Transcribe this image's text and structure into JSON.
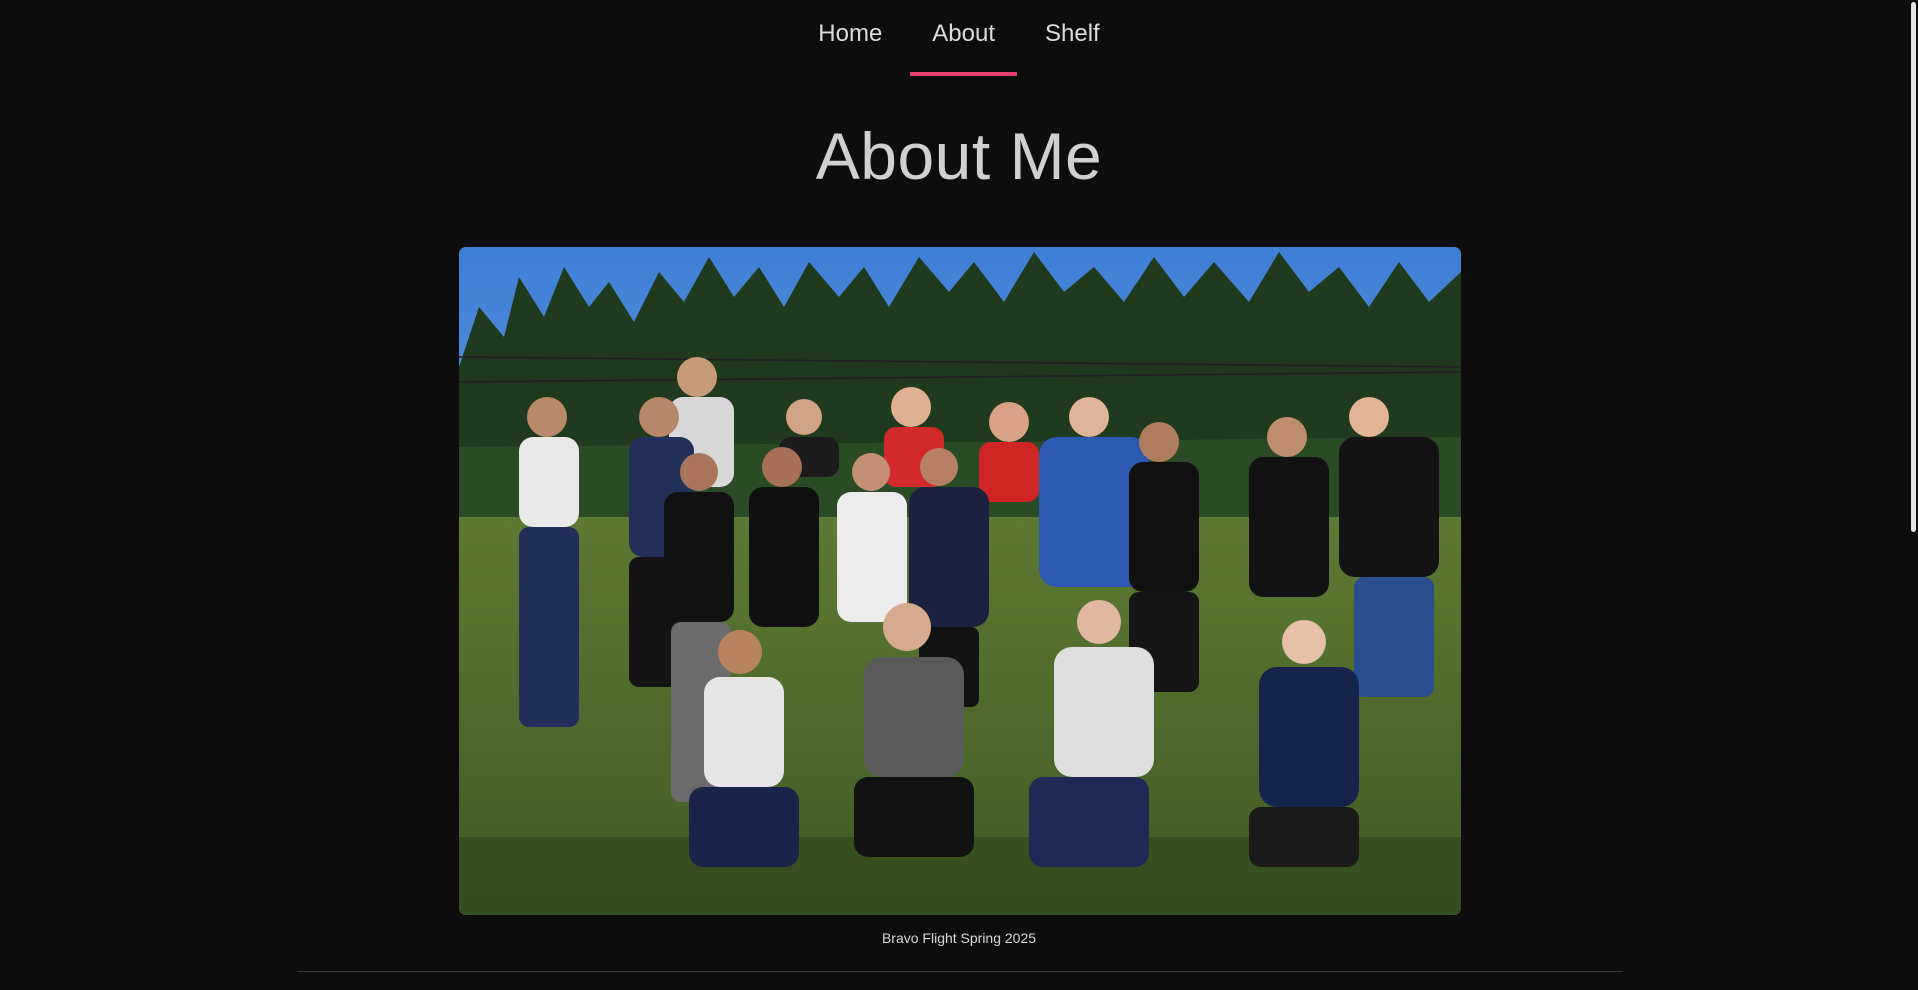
{
  "nav": {
    "items": [
      {
        "label": "Home",
        "active": false
      },
      {
        "label": "About",
        "active": true
      },
      {
        "label": "Shelf",
        "active": false
      }
    ],
    "accent_color": "#e83d6f"
  },
  "page": {
    "title": "About Me"
  },
  "photo": {
    "caption": "Bravo Flight Spring 2025"
  },
  "colors": {
    "background": "#0d0d0d",
    "text": "#cfcfcf"
  }
}
